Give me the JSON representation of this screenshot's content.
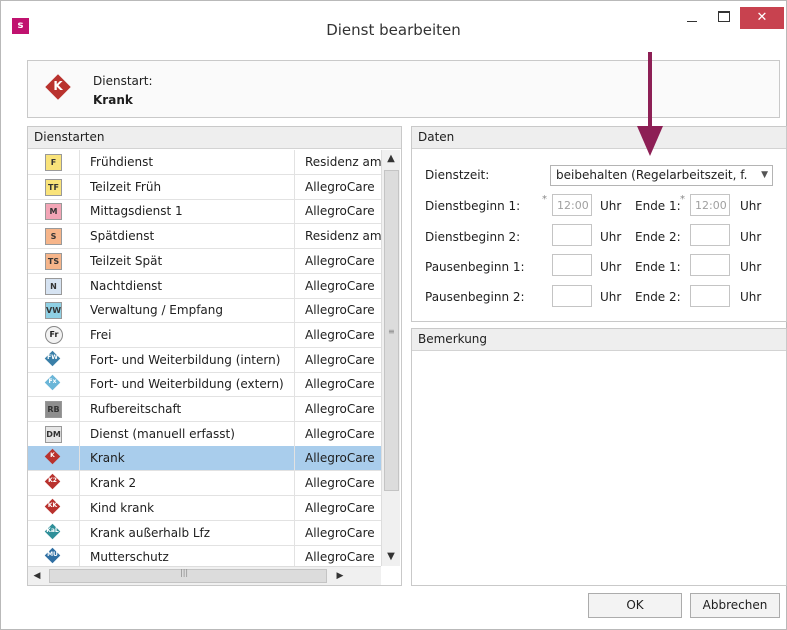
{
  "window": {
    "app_icon_letter": "s",
    "title": "Dienst bearbeiten",
    "close_glyph": "✕"
  },
  "header": {
    "label": "Dienstart:",
    "value": "Krank",
    "icon_letter": "K",
    "icon_color": "#b9322e"
  },
  "dienstarten": {
    "title": "Dienstarten",
    "rows": [
      {
        "icon": {
          "kind": "box",
          "text": "F",
          "bg": "#f9e37a"
        },
        "name": "Frühdienst",
        "org": "Residenz am"
      },
      {
        "icon": {
          "kind": "box",
          "text": "TF",
          "bg": "#f9e37a"
        },
        "name": "Teilzeit Früh",
        "org": "AllegroCare"
      },
      {
        "icon": {
          "kind": "box",
          "text": "M",
          "bg": "#f3a5b6"
        },
        "name": "Mittagsdienst 1",
        "org": "AllegroCare"
      },
      {
        "icon": {
          "kind": "box",
          "text": "S",
          "bg": "#f6b58a"
        },
        "name": "Spätdienst",
        "org": "Residenz am"
      },
      {
        "icon": {
          "kind": "box",
          "text": "TS",
          "bg": "#f6b58a"
        },
        "name": "Teilzeit Spät",
        "org": "AllegroCare"
      },
      {
        "icon": {
          "kind": "box",
          "text": "N",
          "bg": "#d6e3f2"
        },
        "name": "Nachtdienst",
        "org": "AllegroCare"
      },
      {
        "icon": {
          "kind": "box",
          "text": "VW",
          "bg": "#8fd0e4"
        },
        "name": "Verwaltung / Empfang",
        "org": "AllegroCare"
      },
      {
        "icon": {
          "kind": "circle",
          "text": "Fr",
          "bg": "#f2f2f2"
        },
        "name": "Frei",
        "org": "AllegroCare"
      },
      {
        "icon": {
          "kind": "diamond",
          "text": "FW",
          "bg": "#3a7fa8"
        },
        "name": "Fort- und Weiterbildung (intern)",
        "org": "AllegroCare"
      },
      {
        "icon": {
          "kind": "diamond",
          "text": "Fx",
          "bg": "#6bb6d8"
        },
        "name": "Fort- und Weiterbildung (extern)",
        "org": "AllegroCare"
      },
      {
        "icon": {
          "kind": "box",
          "text": "RB",
          "bg": "#8e8e8e"
        },
        "name": "Rufbereitschaft",
        "org": "AllegroCare"
      },
      {
        "icon": {
          "kind": "box",
          "text": "DM",
          "bg": "#e6e6e6"
        },
        "name": "Dienst (manuell erfasst)",
        "org": "AllegroCare"
      },
      {
        "icon": {
          "kind": "diamond",
          "text": "K",
          "bg": "#b9322e"
        },
        "name": "Krank",
        "org": "AllegroCare",
        "selected": true
      },
      {
        "icon": {
          "kind": "diamond",
          "text": "K2",
          "bg": "#b9322e"
        },
        "name": "Krank 2",
        "org": "AllegroCare"
      },
      {
        "icon": {
          "kind": "diamond",
          "text": "KK",
          "bg": "#b9322e"
        },
        "name": "Kind krank",
        "org": "AllegroCare"
      },
      {
        "icon": {
          "kind": "diamond",
          "text": "KaL",
          "bg": "#2f8f99"
        },
        "name": "Krank außerhalb Lfz",
        "org": "AllegroCare"
      },
      {
        "icon": {
          "kind": "diamond",
          "text": "MU",
          "bg": "#2f6fa3"
        },
        "name": "Mutterschutz",
        "org": "AllegroCare"
      }
    ]
  },
  "daten": {
    "title": "Daten",
    "dienstzeit_label": "Dienstzeit:",
    "dienstzeit_value": "beibehalten (Regelarbeitszeit, f.",
    "dienstbeginn1_label": "Dienstbeginn 1:",
    "dienstbeginn1_value": "12:00",
    "ende1_label": "Ende 1:",
    "ende1_value": "12:00",
    "dienstbeginn2_label": "Dienstbeginn 2:",
    "ende2_label": "Ende 2:",
    "pausenbeginn1_label": "Pausenbeginn 1:",
    "pausenende1_label": "Ende 1:",
    "pausenbeginn2_label": "Pausenbeginn 2:",
    "pausenende2_label": "Ende 2:",
    "unit": "Uhr",
    "required_mark": "*"
  },
  "bemerkung": {
    "title": "Bemerkung"
  },
  "buttons": {
    "ok": "OK",
    "cancel": "Abbrechen"
  },
  "annotation": {
    "arrow_color": "#8d1f55"
  }
}
